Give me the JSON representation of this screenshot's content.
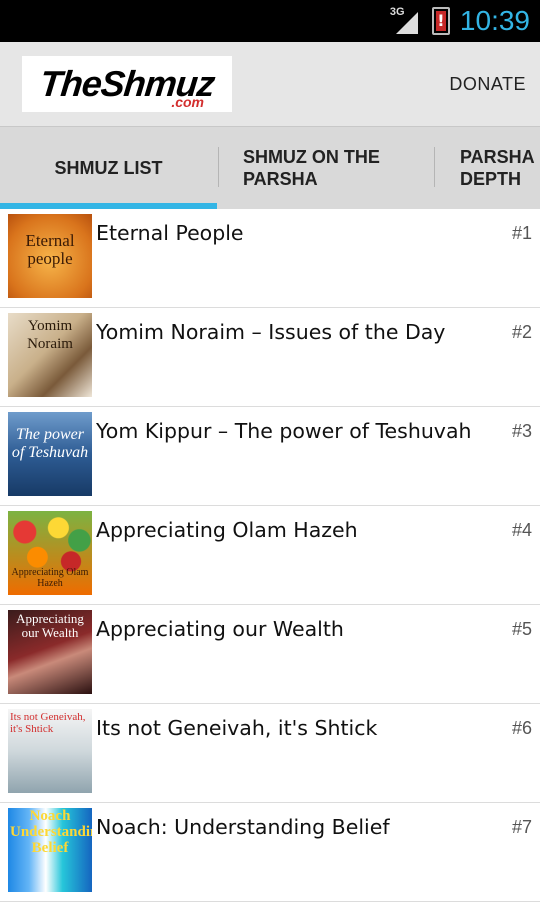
{
  "status": {
    "network": "3G",
    "time": "10:39"
  },
  "app": {
    "logo_text": "TheShmuz",
    "logo_sub": ".com",
    "donate_label": "DONATE"
  },
  "tabs": [
    {
      "label": "SHMUZ LIST",
      "selected": true
    },
    {
      "label": "SHMUZ ON THE PARSHA",
      "selected": false
    },
    {
      "label": "PARSHA DEPTH",
      "selected": false
    }
  ],
  "items": [
    {
      "title": "Eternal People",
      "number": "#1",
      "thumb_caption": "Eternal people"
    },
    {
      "title": "Yomim Noraim – Issues of the Day",
      "number": "#2",
      "thumb_caption": "Yomim Noraim"
    },
    {
      "title": "Yom Kippur – The power of Teshuvah",
      "number": "#3",
      "thumb_caption": "The power of Teshuvah"
    },
    {
      "title": "Appreciating Olam Hazeh",
      "number": "#4",
      "thumb_caption": "Appreciating Olam Hazeh"
    },
    {
      "title": "Appreciating our Wealth",
      "number": "#5",
      "thumb_caption": "Appreciating our Wealth"
    },
    {
      "title": "Its not Geneivah, it's Shtick",
      "number": "#6",
      "thumb_caption": "Its not Geneivah, it's Shtick"
    },
    {
      "title": "Noach: Understanding Belief",
      "number": "#7",
      "thumb_caption": "Noach Understanding Belief"
    }
  ],
  "colors": {
    "accent": "#33b5e5",
    "battery_alert": "#c62828"
  }
}
